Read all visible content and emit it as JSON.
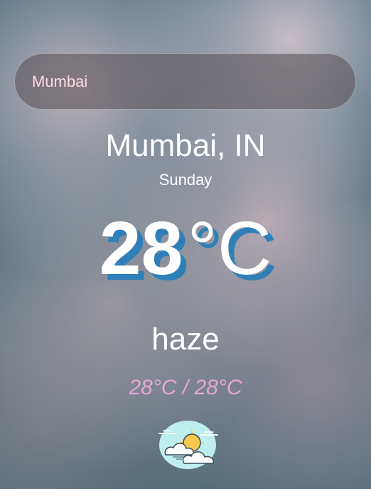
{
  "search": {
    "value": "Mumbai",
    "placeholder": ""
  },
  "weather": {
    "location": "Mumbai, IN",
    "day": "Sunday",
    "temperature": "28",
    "unit": "°C",
    "condition": "haze",
    "range": "28°C / 28°C",
    "icon": "haze-cloud-sun-icon"
  },
  "colors": {
    "accent_shadow": "#2f7fb8",
    "range_text": "#e7a7d5",
    "search_text": "#ffd8e2"
  }
}
